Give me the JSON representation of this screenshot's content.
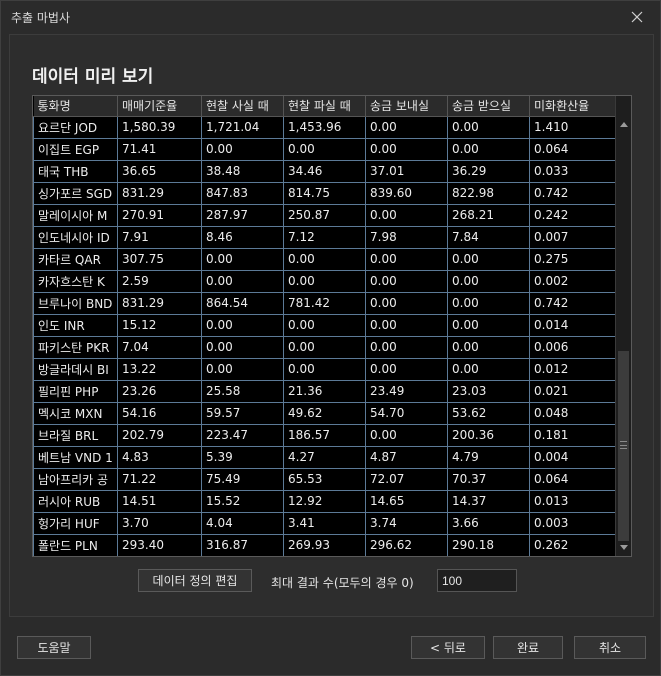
{
  "window": {
    "title": "추출 마법사"
  },
  "page": {
    "heading": "데이터 미리 보기"
  },
  "table": {
    "columns": [
      "통화명",
      "매매기준율",
      "현찰 사실 때",
      "현찰 파실 때",
      "송금 보내실",
      "송금 받으실",
      "미화환산율"
    ],
    "rows": [
      [
        "요르단 JOD",
        "1,580.39",
        "1,721.04",
        "1,453.96",
        "0.00",
        "0.00",
        "1.410"
      ],
      [
        "이집트 EGP",
        "71.41",
        "0.00",
        "0.00",
        "0.00",
        "0.00",
        "0.064"
      ],
      [
        "태국 THB",
        "36.65",
        "38.48",
        "34.46",
        "37.01",
        "36.29",
        "0.033"
      ],
      [
        "싱가포르 SGD",
        "831.29",
        "847.83",
        "814.75",
        "839.60",
        "822.98",
        "0.742"
      ],
      [
        "말레이시아 M",
        "270.91",
        "287.97",
        "250.87",
        "0.00",
        "268.21",
        "0.242"
      ],
      [
        "인도네시아 ID",
        "7.91",
        "8.46",
        "7.12",
        "7.98",
        "7.84",
        "0.007"
      ],
      [
        "카타르 QAR",
        "307.75",
        "0.00",
        "0.00",
        "0.00",
        "0.00",
        "0.275"
      ],
      [
        "카자흐스탄 K",
        "2.59",
        "0.00",
        "0.00",
        "0.00",
        "0.00",
        "0.002"
      ],
      [
        "브루나이 BND",
        "831.29",
        "864.54",
        "781.42",
        "0.00",
        "0.00",
        "0.742"
      ],
      [
        "인도 INR",
        "15.12",
        "0.00",
        "0.00",
        "0.00",
        "0.00",
        "0.014"
      ],
      [
        "파키스탄 PKR",
        "7.04",
        "0.00",
        "0.00",
        "0.00",
        "0.00",
        "0.006"
      ],
      [
        "방글라데시 BI",
        "13.22",
        "0.00",
        "0.00",
        "0.00",
        "0.00",
        "0.012"
      ],
      [
        "필리핀 PHP",
        "23.26",
        "25.58",
        "21.36",
        "23.49",
        "23.03",
        "0.021"
      ],
      [
        "멕시코 MXN",
        "54.16",
        "59.57",
        "49.62",
        "54.70",
        "53.62",
        "0.048"
      ],
      [
        "브라질 BRL",
        "202.79",
        "223.47",
        "186.57",
        "0.00",
        "200.36",
        "0.181"
      ],
      [
        "베트남 VND 1",
        "4.83",
        "5.39",
        "4.27",
        "4.87",
        "4.79",
        "0.004"
      ],
      [
        "남아프리카 공",
        "71.22",
        "75.49",
        "65.53",
        "72.07",
        "70.37",
        "0.064"
      ],
      [
        "러시아 RUB",
        "14.51",
        "15.52",
        "12.92",
        "14.65",
        "14.37",
        "0.013"
      ],
      [
        "헝가리 HUF",
        "3.70",
        "4.04",
        "3.41",
        "3.74",
        "3.66",
        "0.003"
      ],
      [
        "폴란드 PLN",
        "293.40",
        "316.87",
        "269.93",
        "296.62",
        "290.18",
        "0.262"
      ]
    ]
  },
  "controls": {
    "edit_button": "데이터 정의 편집",
    "max_results_label": "최대 결과 수(모두의 경우 0)",
    "max_results_value": "100"
  },
  "footer": {
    "help": "도움말",
    "back": "< 뒤로",
    "finish": "완료",
    "cancel": "취소"
  },
  "colors": {
    "background": "#2b2b2b",
    "grid_background": "#000000",
    "grid_line": "#5c7a97"
  }
}
